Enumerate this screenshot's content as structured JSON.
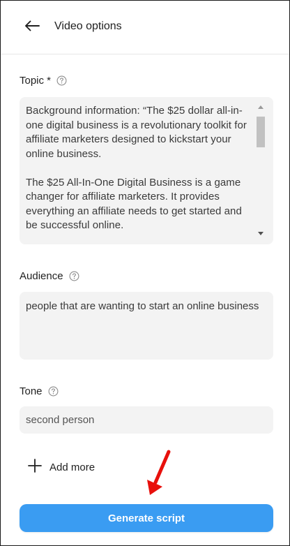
{
  "header": {
    "back_icon": "arrow-left-icon",
    "title": "Video options"
  },
  "topic": {
    "label": "Topic *",
    "help_icon": "question-circle-icon",
    "value": "Background information: “The $25 dollar all-in-one digital business is a revolutionary toolkit for affiliate marketers designed to kickstart your online business.\n\nThe $25 All-In-One Digital Business is a game changer for affiliate marketers. It provides everything an affiliate needs to get started and be successful online."
  },
  "audience": {
    "label": "Audience",
    "help_icon": "question-circle-icon",
    "value": "people that are wanting to start an online business"
  },
  "tone": {
    "label": "Tone",
    "help_icon": "question-circle-icon",
    "value": "second person"
  },
  "add_more": {
    "icon": "plus-icon",
    "label": "Add more"
  },
  "generate": {
    "label": "Generate script"
  },
  "colors": {
    "accent": "#3a9cf2",
    "annotation_arrow": "#e8100c",
    "field_background": "#f3f3f3"
  }
}
